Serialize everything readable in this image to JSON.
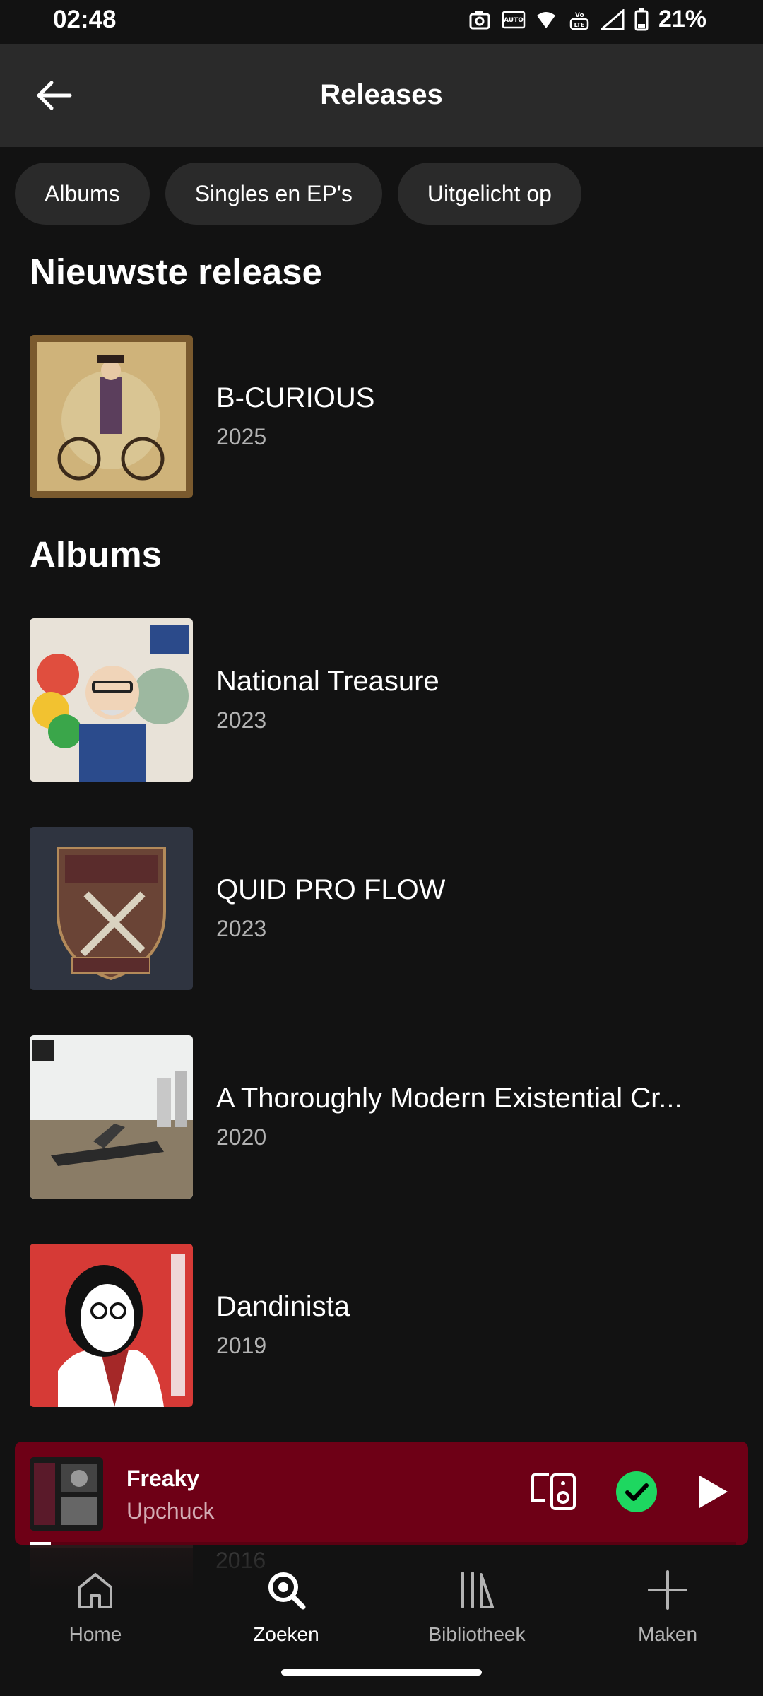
{
  "status": {
    "time": "02:48",
    "battery": "21%"
  },
  "header": {
    "title": "Releases",
    "back_icon": "arrow-left-icon"
  },
  "chips": [
    "Albums",
    "Singles en EP's",
    "Uitgelicht op"
  ],
  "sections": {
    "newest_title": "Nieuwste release",
    "albums_title": "Albums"
  },
  "newest": {
    "title": "B-CURIOUS",
    "year": "2025"
  },
  "albums": [
    {
      "title": "National Treasure",
      "year": "2023"
    },
    {
      "title": "QUID PRO FLOW",
      "year": "2023"
    },
    {
      "title": "A Thoroughly Modern Existential Cr...",
      "year": "2020"
    },
    {
      "title": "Dandinista",
      "year": "2019"
    }
  ],
  "partial_album": {
    "year": "2016"
  },
  "mini_player": {
    "title": "Freaky",
    "artist": "Upchuck",
    "progress": 0.03
  },
  "nav": [
    {
      "label": "Home",
      "icon": "home-icon"
    },
    {
      "label": "Zoeken",
      "icon": "search-icon",
      "active": true
    },
    {
      "label": "Bibliotheek",
      "icon": "library-icon"
    },
    {
      "label": "Maken",
      "icon": "plus-icon"
    }
  ],
  "colors": {
    "accent_green": "#1ed760",
    "player_bg": "#6e0016"
  }
}
